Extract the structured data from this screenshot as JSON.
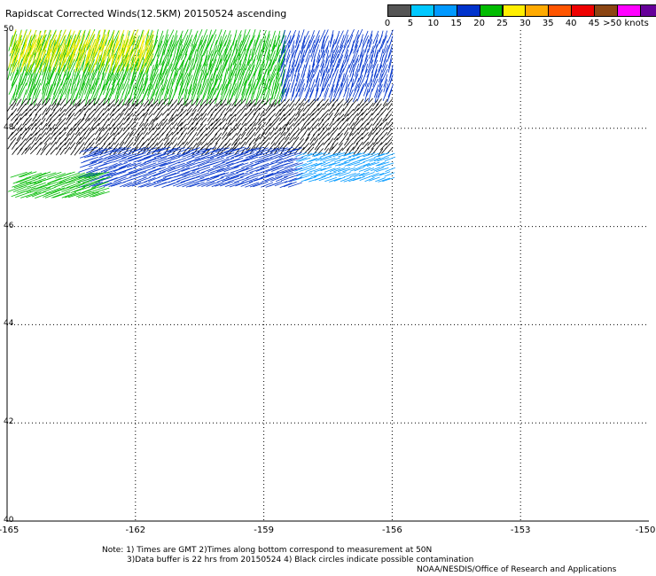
{
  "title": "Rapidscat Corrected Winds(12.5KM) 20150524 ascending",
  "colorbar": {
    "labels": [
      "0",
      "5",
      "10",
      "15",
      "20",
      "25",
      "30",
      "35",
      "40",
      "45",
      ">50 knots"
    ],
    "colors": [
      "#555555",
      "#00c8ff",
      "#0099ff",
      "#0033cc",
      "#00bb00",
      "#ffee00",
      "#ffaa00",
      "#ff5500",
      "#ee0000",
      "#8b4513",
      "#ff00ff",
      "#660099"
    ]
  },
  "chart_data": {
    "type": "scatter",
    "title": "Rapidscat Corrected Winds(12.5KM) 20150524 ascending",
    "x_ticks": [
      "-165",
      "-162",
      "-159",
      "-156",
      "-153",
      "-150"
    ],
    "y_ticks": [
      "40",
      "42",
      "44",
      "46",
      "48",
      "50"
    ],
    "xlim": [
      -165,
      -150
    ],
    "ylim": [
      40,
      50
    ],
    "grid": true,
    "swath": {
      "lon_min": -165,
      "lon_max": -155.9,
      "lat_min": 46.7,
      "lat_max": 50
    },
    "bands": [
      {
        "lat_range": [
          48.8,
          50.0
        ],
        "lon_range": [
          -165.0,
          -158.5
        ],
        "speed_knots": 18,
        "direction": "SSW"
      },
      {
        "lat_range": [
          49.5,
          50.0
        ],
        "lon_range": [
          -165.0,
          -161.5
        ],
        "speed_knots": 22,
        "direction": "SSW"
      },
      {
        "lat_range": [
          48.8,
          50.0
        ],
        "lon_range": [
          -158.5,
          -155.9
        ],
        "speed_knots": 12,
        "direction": "SSW"
      },
      {
        "lat_range": [
          47.6,
          48.6
        ],
        "lon_range": [
          -165.0,
          -155.9
        ],
        "speed_knots": 2,
        "direction": "SW"
      },
      {
        "lat_range": [
          46.9,
          47.6
        ],
        "lon_range": [
          -163.0,
          -158.0
        ],
        "speed_knots": 13,
        "direction": "WSW"
      },
      {
        "lat_range": [
          47.0,
          47.5
        ],
        "lon_range": [
          -158.0,
          -155.9
        ],
        "speed_knots": 8,
        "direction": "WSW"
      },
      {
        "lat_range": [
          46.7,
          47.1
        ],
        "lon_range": [
          -165.0,
          -162.5
        ],
        "speed_knots": 17,
        "direction": "WSW"
      }
    ]
  },
  "notes": {
    "line1": "Note: 1) Times are GMT 2)Times along bottom correspond to measurement at 50N",
    "line2": "3)Data buffer is 22 hrs from 20150524 4) Black circles indicate possible contamination",
    "line3": "NOAA/NESDIS/Office of Research and Applications"
  }
}
